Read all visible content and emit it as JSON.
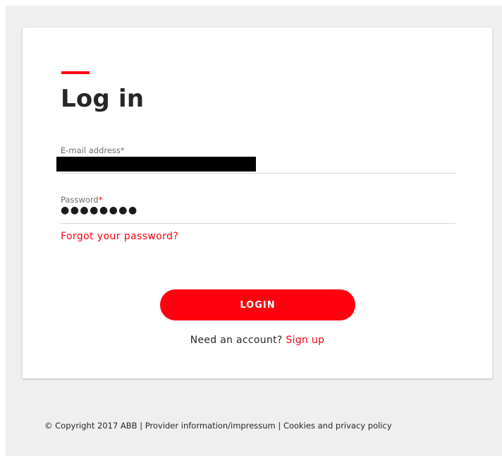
{
  "login": {
    "title": "Log in",
    "email": {
      "label": "E-mail address",
      "required_marker": "*"
    },
    "password": {
      "label": "Password",
      "required_marker": "*",
      "masked_value": "●●●●●●●●"
    },
    "forgot_password": "Forgot your password?",
    "login_button": "LOGIN",
    "signup": {
      "prompt": "Need an account?",
      "link": "Sign up"
    }
  },
  "footer": {
    "copyright": "© Copyright 2017 ABB",
    "separator": "|",
    "provider_info": "Provider information/impressum",
    "cookies_policy": "Cookies and privacy policy"
  },
  "colors": {
    "accent": "#ff000f",
    "background": "#efefef"
  }
}
